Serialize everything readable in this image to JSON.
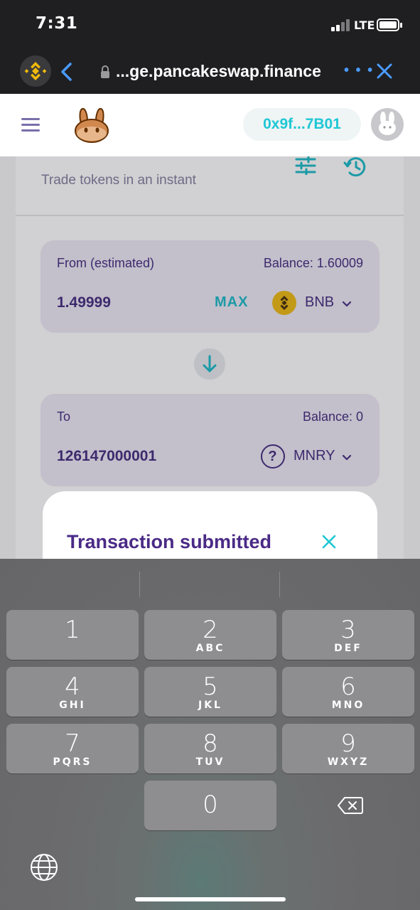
{
  "status_bar": {
    "time": "7:31",
    "network": "LTE"
  },
  "browser": {
    "url": "...ge.pancakeswap.finance",
    "more_label": "• • •"
  },
  "header": {
    "wallet_address": "0x9f...7B01"
  },
  "swap": {
    "subtitle": "Trade tokens in an instant",
    "from": {
      "label": "From (estimated)",
      "balance": "Balance: 1.60009",
      "amount": "1.49999",
      "max_label": "MAX",
      "token": "BNB"
    },
    "to": {
      "label": "To",
      "balance": "Balance: 0",
      "amount": "126147000001",
      "token": "MNRY"
    }
  },
  "modal": {
    "title": "Transaction submitted"
  },
  "keyboard": {
    "keys": [
      {
        "digit": "1",
        "letters": ""
      },
      {
        "digit": "2",
        "letters": "ABC"
      },
      {
        "digit": "3",
        "letters": "DEF"
      },
      {
        "digit": "4",
        "letters": "GHI"
      },
      {
        "digit": "5",
        "letters": "JKL"
      },
      {
        "digit": "6",
        "letters": "MNO"
      },
      {
        "digit": "7",
        "letters": "PQRS"
      },
      {
        "digit": "8",
        "letters": "TUV"
      },
      {
        "digit": "9",
        "letters": "WXYZ"
      },
      {
        "digit": "0",
        "letters": ""
      }
    ]
  },
  "colors": {
    "accent": "#1fc7d4",
    "primary_text": "#280d5f",
    "modal_title": "#4a2a86",
    "bnb_yellow": "#f0b90b"
  },
  "icons": [
    "binance-favicon-icon",
    "back-arrow-icon",
    "lock-icon",
    "close-icon",
    "hamburger-menu-icon",
    "pancakeswap-logo",
    "bunny-avatar-icon",
    "settings-sliders-icon",
    "history-icon",
    "bnb-token-icon",
    "unknown-token-icon",
    "chevron-down-icon",
    "arrow-down-icon",
    "delete-key-icon",
    "globe-icon"
  ]
}
